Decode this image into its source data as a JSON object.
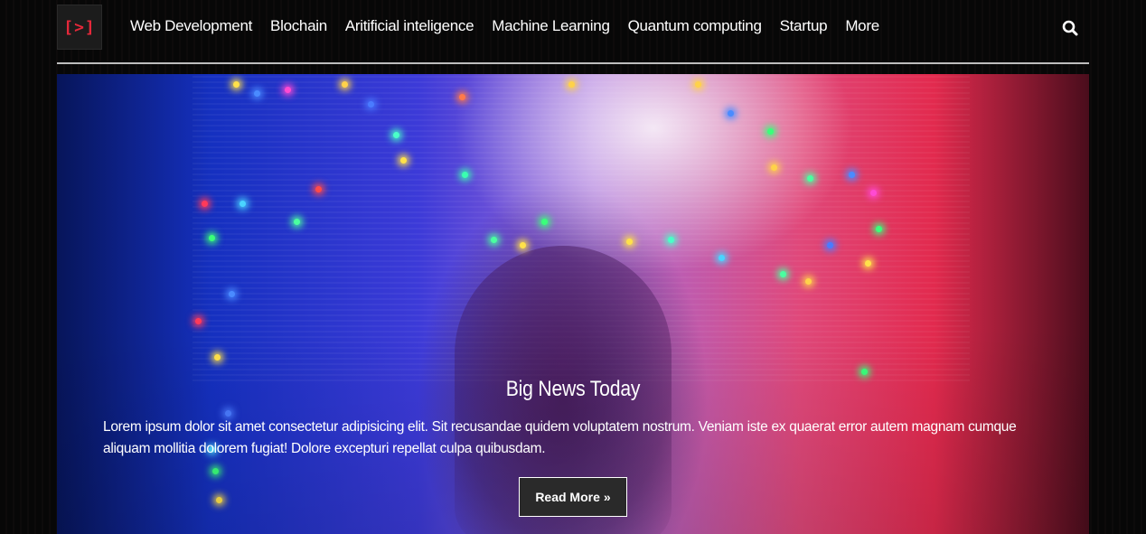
{
  "logo": {
    "text": "[>]"
  },
  "nav": {
    "items": [
      {
        "label": "Web Development"
      },
      {
        "label": "Blochain"
      },
      {
        "label": "Aritificial inteligence"
      },
      {
        "label": "Machine Learning"
      },
      {
        "label": "Quantum computing"
      },
      {
        "label": "Startup"
      },
      {
        "label": "More"
      }
    ],
    "search_icon": "search-icon"
  },
  "hero": {
    "title": "Big News Today",
    "text": "Lorem ipsum dolor sit amet consectetur adipisicing elit. Sit recusandae quidem voluptatem nostrum. Veniam iste ex quaerat error autem magnam cumque aliquam mollitia dolorem fugiat! Dolore excepturi repellat culpa quibusdam.",
    "button_label": "Read More",
    "button_icon": "double-chevron-right-icon"
  },
  "colors": {
    "logo_accent": "#e5283a",
    "page_background": "#050505",
    "button_background": "#2a2a2a"
  }
}
